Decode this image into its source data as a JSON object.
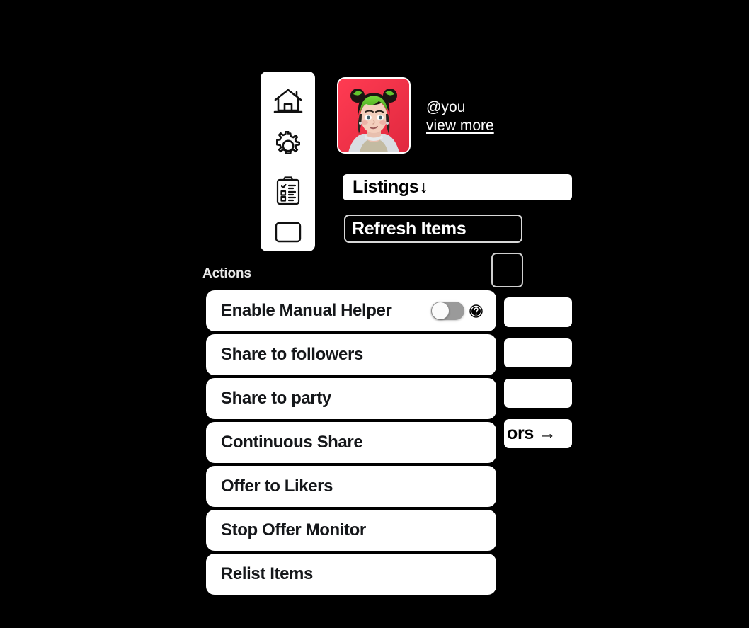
{
  "theme": {
    "background": "#000000",
    "surface": "#ffffff",
    "text_on_surface": "#15171a",
    "text_on_background": "#ffffff",
    "avatar_background": "#f0344a",
    "toggle_track_off": "#9a9a9a",
    "toggle_knob": "#fbfbfb",
    "outline": "#d8d8d8"
  },
  "rail": {
    "items": [
      {
        "icon": "home-icon",
        "label": "Home"
      },
      {
        "icon": "gear-icon",
        "label": "Settings"
      },
      {
        "icon": "clipboard-checklist-icon",
        "label": "Tasks"
      },
      {
        "icon": "card-icon",
        "label": "Card"
      }
    ]
  },
  "profile": {
    "avatar_alt": "avatar",
    "handle": "@you",
    "view_more": "view more"
  },
  "toolbar": {
    "listings_select": {
      "value": "Listings",
      "arrow": "↓"
    },
    "refresh_button": "Refresh Items"
  },
  "right_column": {
    "cta_partial_label": "ors →",
    "stub_count": 3
  },
  "actions": {
    "section_label": "Actions",
    "items": [
      {
        "label": "Enable Manual Helper",
        "has_toggle": true,
        "toggle_on": false,
        "has_help": true,
        "help_icon": "question-mark-circle-icon"
      },
      {
        "label": "Share to followers",
        "has_toggle": false,
        "has_help": false
      },
      {
        "label": "Share to party",
        "has_toggle": false,
        "has_help": false
      },
      {
        "label": "Continuous Share",
        "has_toggle": false,
        "has_help": false
      },
      {
        "label": "Offer to Likers",
        "has_toggle": false,
        "has_help": false
      },
      {
        "label": "Stop Offer Monitor",
        "has_toggle": false,
        "has_help": false
      },
      {
        "label": "Relist Items",
        "has_toggle": false,
        "has_help": false
      }
    ]
  }
}
